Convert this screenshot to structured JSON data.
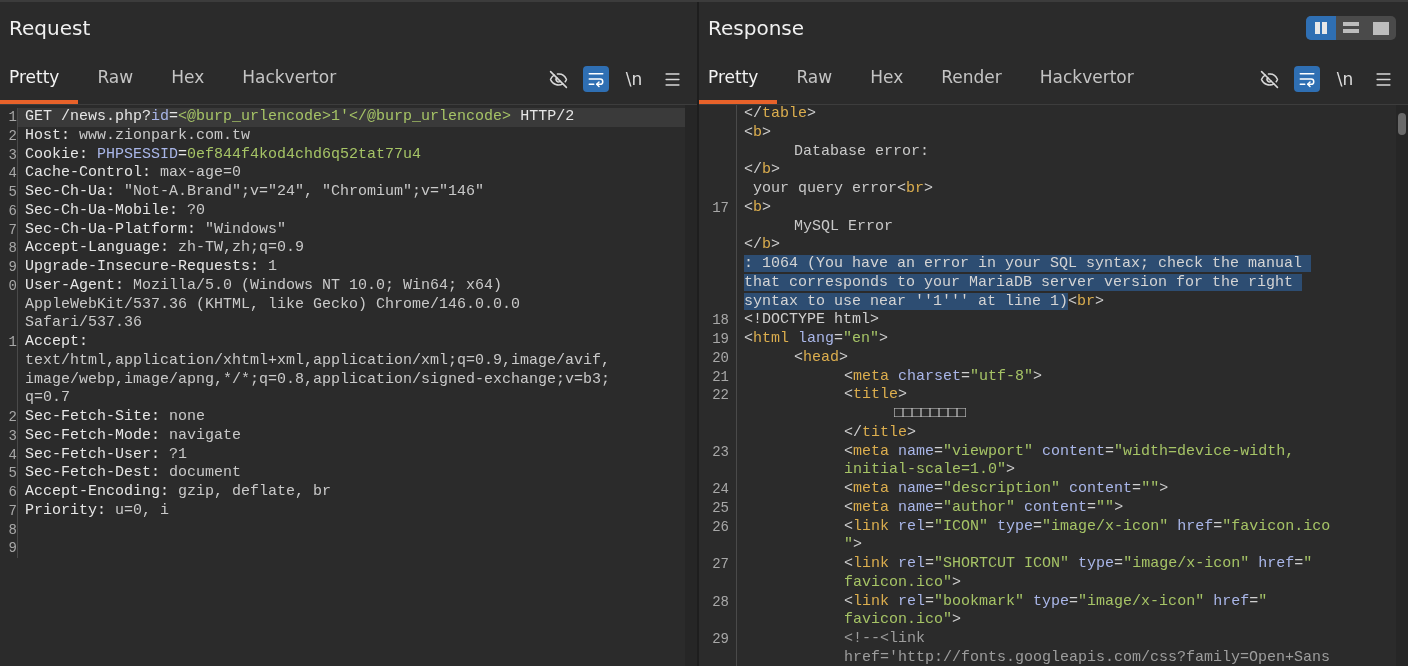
{
  "request": {
    "title": "Request",
    "tabs": [
      {
        "label": "Pretty",
        "selected": true
      },
      {
        "label": "Raw",
        "selected": false
      },
      {
        "label": "Hex",
        "selected": false
      },
      {
        "label": "Hackvertor",
        "selected": false
      }
    ],
    "toolbar": [
      {
        "kind": "hide",
        "active": false
      },
      {
        "kind": "wrap",
        "active": true
      },
      {
        "kind": "text",
        "label": "\\n",
        "active": false
      },
      {
        "kind": "menu",
        "active": false
      }
    ],
    "lines": [
      {
        "num": "1",
        "current": true,
        "spans": [
          {
            "kind": "k",
            "text": "GET /news.php?"
          },
          {
            "kind": "a",
            "text": "id"
          },
          {
            "kind": "k",
            "text": "="
          },
          {
            "kind": "v",
            "text": "<@burp_urlencode>1'</@burp_urlencode>"
          },
          {
            "kind": "k",
            "text": " HTTP/2"
          }
        ]
      },
      {
        "num": "2",
        "current": false,
        "spans": [
          {
            "kind": "k",
            "text": "Host: "
          },
          {
            "kind": "x",
            "text": "www.zionpark.com.tw"
          }
        ]
      },
      {
        "num": "3",
        "current": false,
        "spans": [
          {
            "kind": "k",
            "text": "Cookie: "
          },
          {
            "kind": "a",
            "text": "PHPSESSID"
          },
          {
            "kind": "k",
            "text": "="
          },
          {
            "kind": "v",
            "text": "0ef844f4kod4chd6q52tat77u4"
          }
        ]
      },
      {
        "num": "4",
        "current": false,
        "spans": [
          {
            "kind": "k",
            "text": "Cache-Control: "
          },
          {
            "kind": "x",
            "text": "max-age=0"
          }
        ]
      },
      {
        "num": "5",
        "current": false,
        "spans": [
          {
            "kind": "k",
            "text": "Sec-Ch-Ua: "
          },
          {
            "kind": "x",
            "text": "\"Not-A.Brand\";v=\"24\", \"Chromium\";v=\"146\""
          }
        ]
      },
      {
        "num": "6",
        "current": false,
        "spans": [
          {
            "kind": "k",
            "text": "Sec-Ch-Ua-Mobile: "
          },
          {
            "kind": "x",
            "text": "?0"
          }
        ]
      },
      {
        "num": "7",
        "current": false,
        "spans": [
          {
            "kind": "k",
            "text": "Sec-Ch-Ua-Platform: "
          },
          {
            "kind": "x",
            "text": "\"Windows\""
          }
        ]
      },
      {
        "num": "8",
        "current": false,
        "spans": [
          {
            "kind": "k",
            "text": "Accept-Language: "
          },
          {
            "kind": "x",
            "text": "zh-TW,zh;q=0.9"
          }
        ]
      },
      {
        "num": "9",
        "current": false,
        "spans": [
          {
            "kind": "k",
            "text": "Upgrade-Insecure-Requests: "
          },
          {
            "kind": "x",
            "text": "1"
          }
        ]
      },
      {
        "num": "0",
        "current": false,
        "spans": [
          {
            "kind": "k",
            "text": "User-Agent: "
          },
          {
            "kind": "x",
            "text": "Mozilla/5.0 (Windows NT 10.0; Win64; x64)"
          }
        ]
      },
      {
        "current": false,
        "spans": [
          {
            "kind": "x",
            "text": "AppleWebKit/537.36 (KHTML, like Gecko) Chrome/146.0.0.0"
          }
        ]
      },
      {
        "current": false,
        "spans": [
          {
            "kind": "x",
            "text": "Safari/537.36"
          }
        ]
      },
      {
        "num": "1",
        "current": false,
        "spans": [
          {
            "kind": "k",
            "text": "Accept:"
          }
        ]
      },
      {
        "current": false,
        "spans": [
          {
            "kind": "x",
            "text": "text/html,application/xhtml+xml,application/xml;q=0.9,image/avif,"
          }
        ]
      },
      {
        "current": false,
        "spans": [
          {
            "kind": "x",
            "text": "image/webp,image/apng,*/*;q=0.8,application/signed-exchange;v=b3;"
          }
        ]
      },
      {
        "current": false,
        "spans": [
          {
            "kind": "x",
            "text": "q=0.7"
          }
        ]
      },
      {
        "num": "2",
        "current": false,
        "spans": [
          {
            "kind": "k",
            "text": "Sec-Fetch-Site: "
          },
          {
            "kind": "x",
            "text": "none"
          }
        ]
      },
      {
        "num": "3",
        "current": false,
        "spans": [
          {
            "kind": "k",
            "text": "Sec-Fetch-Mode: "
          },
          {
            "kind": "x",
            "text": "navigate"
          }
        ]
      },
      {
        "num": "4",
        "current": false,
        "spans": [
          {
            "kind": "k",
            "text": "Sec-Fetch-User: "
          },
          {
            "kind": "x",
            "text": "?1"
          }
        ]
      },
      {
        "num": "5",
        "current": false,
        "spans": [
          {
            "kind": "k",
            "text": "Sec-Fetch-Dest: "
          },
          {
            "kind": "x",
            "text": "document"
          }
        ]
      },
      {
        "num": "6",
        "current": false,
        "spans": [
          {
            "kind": "k",
            "text": "Accept-Encoding: "
          },
          {
            "kind": "x",
            "text": "gzip, deflate, br"
          }
        ]
      },
      {
        "num": "7",
        "current": false,
        "spans": [
          {
            "kind": "k",
            "text": "Priority: "
          },
          {
            "kind": "x",
            "text": "u=0, i"
          }
        ]
      },
      {
        "num": "8",
        "current": false
      },
      {
        "num": "9",
        "current": false
      }
    ]
  },
  "response": {
    "title": "Response",
    "layout_buttons": [
      {
        "kind": "columns",
        "selected": true
      },
      {
        "kind": "rows",
        "selected": false
      },
      {
        "kind": "single",
        "selected": false
      }
    ],
    "tabs": [
      {
        "label": "Pretty",
        "selected": true
      },
      {
        "label": "Raw",
        "selected": false
      },
      {
        "label": "Hex",
        "selected": false
      },
      {
        "label": "Render",
        "selected": false
      },
      {
        "label": "Hackvertor",
        "selected": false
      }
    ],
    "toolbar": [
      {
        "kind": "hide",
        "active": false
      },
      {
        "kind": "wrap",
        "active": true
      },
      {
        "kind": "text",
        "label": "\\n",
        "active": false
      },
      {
        "kind": "menu",
        "active": false
      }
    ],
    "lines": [
      {
        "spans": [
          {
            "kind": "p",
            "text": "</"
          },
          {
            "kind": "t",
            "text": "table"
          },
          {
            "kind": "p",
            "text": ">"
          }
        ]
      },
      {
        "spans": [
          {
            "kind": "p",
            "text": "<"
          },
          {
            "kind": "t",
            "text": "b"
          },
          {
            "kind": "p",
            "text": ">"
          }
        ]
      },
      {
        "spans": [
          {
            "kind": "x",
            "text": "\tDatabase error:"
          }
        ]
      },
      {
        "spans": [
          {
            "kind": "p",
            "text": "</"
          },
          {
            "kind": "t",
            "text": "b"
          },
          {
            "kind": "p",
            "text": ">"
          }
        ]
      },
      {
        "spans": [
          {
            "kind": "x",
            "text": " your query error"
          },
          {
            "kind": "p",
            "text": "<"
          },
          {
            "kind": "t",
            "text": "br"
          },
          {
            "kind": "p",
            "text": ">"
          }
        ]
      },
      {
        "num": "17",
        "spans": [
          {
            "kind": "p",
            "text": "<"
          },
          {
            "kind": "t",
            "text": "b"
          },
          {
            "kind": "p",
            "text": ">"
          }
        ]
      },
      {
        "spans": [
          {
            "kind": "x",
            "text": "\tMySQL Error"
          }
        ]
      },
      {
        "spans": [
          {
            "kind": "p",
            "text": "</"
          },
          {
            "kind": "t",
            "text": "b"
          },
          {
            "kind": "p",
            "text": ">"
          }
        ]
      },
      {
        "spans": [
          {
            "kind": "s",
            "text": ": 1064 (You have an error in your SQL syntax; check the manual "
          }
        ]
      },
      {
        "spans": [
          {
            "kind": "s",
            "text": "that corresponds to your MariaDB server version for the right "
          }
        ]
      },
      {
        "spans": [
          {
            "kind": "s",
            "text": "syntax to use near ''1''' at line 1)"
          },
          {
            "kind": "p",
            "text": "<"
          },
          {
            "kind": "t",
            "text": "br"
          },
          {
            "kind": "p",
            "text": ">"
          }
        ]
      },
      {
        "num": "18",
        "spans": [
          {
            "kind": "p",
            "text": "<!DOCTYPE html>"
          }
        ]
      },
      {
        "num": "19",
        "spans": [
          {
            "kind": "p",
            "text": "<"
          },
          {
            "kind": "t",
            "text": "html"
          },
          {
            "kind": "a",
            "text": " lang"
          },
          {
            "kind": "p",
            "text": "="
          },
          {
            "kind": "v",
            "text": "\"en\""
          },
          {
            "kind": "p",
            "text": ">"
          }
        ]
      },
      {
        "num": "20",
        "spans": [
          {
            "kind": "p",
            "text": "\t<"
          },
          {
            "kind": "t",
            "text": "head"
          },
          {
            "kind": "p",
            "text": ">"
          }
        ]
      },
      {
        "num": "21",
        "spans": [
          {
            "kind": "p",
            "text": "\t\t<"
          },
          {
            "kind": "t",
            "text": "meta"
          },
          {
            "kind": "a",
            "text": " charset"
          },
          {
            "kind": "p",
            "text": "="
          },
          {
            "kind": "v",
            "text": "\"utf-8\""
          },
          {
            "kind": "p",
            "text": ">"
          }
        ]
      },
      {
        "num": "22",
        "spans": [
          {
            "kind": "p",
            "text": "\t\t<"
          },
          {
            "kind": "t",
            "text": "title"
          },
          {
            "kind": "p",
            "text": ">"
          }
        ]
      },
      {
        "spans": [
          {
            "kind": "x",
            "text": "\t\t\t□□□□□□□□"
          }
        ]
      },
      {
        "spans": [
          {
            "kind": "p",
            "text": "\t\t</"
          },
          {
            "kind": "t",
            "text": "title"
          },
          {
            "kind": "p",
            "text": ">"
          }
        ]
      },
      {
        "num": "23",
        "spans": [
          {
            "kind": "p",
            "text": "\t\t<"
          },
          {
            "kind": "t",
            "text": "meta"
          },
          {
            "kind": "a",
            "text": " name"
          },
          {
            "kind": "p",
            "text": "="
          },
          {
            "kind": "v",
            "text": "\"viewport\""
          },
          {
            "kind": "a",
            "text": " content"
          },
          {
            "kind": "p",
            "text": "="
          },
          {
            "kind": "v",
            "text": "\"width=device-width,"
          }
        ]
      },
      {
        "spans": [
          {
            "kind": "v",
            "text": "\t\tinitial-scale=1.0\""
          },
          {
            "kind": "p",
            "text": ">"
          }
        ]
      },
      {
        "num": "24",
        "spans": [
          {
            "kind": "p",
            "text": "\t\t<"
          },
          {
            "kind": "t",
            "text": "meta"
          },
          {
            "kind": "a",
            "text": " name"
          },
          {
            "kind": "p",
            "text": "="
          },
          {
            "kind": "v",
            "text": "\"description\""
          },
          {
            "kind": "a",
            "text": " content"
          },
          {
            "kind": "p",
            "text": "="
          },
          {
            "kind": "v",
            "text": "\"\""
          },
          {
            "kind": "p",
            "text": ">"
          }
        ]
      },
      {
        "num": "25",
        "spans": [
          {
            "kind": "p",
            "text": "\t\t<"
          },
          {
            "kind": "t",
            "text": "meta"
          },
          {
            "kind": "a",
            "text": " name"
          },
          {
            "kind": "p",
            "text": "="
          },
          {
            "kind": "v",
            "text": "\"author\""
          },
          {
            "kind": "a",
            "text": " content"
          },
          {
            "kind": "p",
            "text": "="
          },
          {
            "kind": "v",
            "text": "\"\""
          },
          {
            "kind": "p",
            "text": ">"
          }
        ]
      },
      {
        "num": "26",
        "spans": [
          {
            "kind": "p",
            "text": "\t\t<"
          },
          {
            "kind": "t",
            "text": "link"
          },
          {
            "kind": "a",
            "text": " rel"
          },
          {
            "kind": "p",
            "text": "="
          },
          {
            "kind": "v",
            "text": "\"ICON\""
          },
          {
            "kind": "a",
            "text": " type"
          },
          {
            "kind": "p",
            "text": "="
          },
          {
            "kind": "v",
            "text": "\"image/x-icon\""
          },
          {
            "kind": "a",
            "text": " href"
          },
          {
            "kind": "p",
            "text": "="
          },
          {
            "kind": "v",
            "text": "\"favicon.ico"
          }
        ]
      },
      {
        "spans": [
          {
            "kind": "v",
            "text": "\t\t\""
          },
          {
            "kind": "p",
            "text": ">"
          }
        ]
      },
      {
        "num": "27",
        "spans": [
          {
            "kind": "p",
            "text": "\t\t<"
          },
          {
            "kind": "t",
            "text": "link"
          },
          {
            "kind": "a",
            "text": " rel"
          },
          {
            "kind": "p",
            "text": "="
          },
          {
            "kind": "v",
            "text": "\"SHORTCUT ICON\""
          },
          {
            "kind": "a",
            "text": " type"
          },
          {
            "kind": "p",
            "text": "="
          },
          {
            "kind": "v",
            "text": "\"image/x-icon\""
          },
          {
            "kind": "a",
            "text": " href"
          },
          {
            "kind": "p",
            "text": "="
          },
          {
            "kind": "v",
            "text": "\""
          }
        ]
      },
      {
        "spans": [
          {
            "kind": "v",
            "text": "\t\tfavicon.ico\""
          },
          {
            "kind": "p",
            "text": ">"
          }
        ]
      },
      {
        "num": "28",
        "spans": [
          {
            "kind": "p",
            "text": "\t\t<"
          },
          {
            "kind": "t",
            "text": "link"
          },
          {
            "kind": "a",
            "text": " rel"
          },
          {
            "kind": "p",
            "text": "="
          },
          {
            "kind": "v",
            "text": "\"bookmark\""
          },
          {
            "kind": "a",
            "text": " type"
          },
          {
            "kind": "p",
            "text": "="
          },
          {
            "kind": "v",
            "text": "\"image/x-icon\""
          },
          {
            "kind": "a",
            "text": " href"
          },
          {
            "kind": "p",
            "text": "="
          },
          {
            "kind": "v",
            "text": "\""
          }
        ]
      },
      {
        "spans": [
          {
            "kind": "v",
            "text": "\t\tfavicon.ico\""
          },
          {
            "kind": "p",
            "text": ">"
          }
        ]
      },
      {
        "num": "29",
        "spans": [
          {
            "kind": "c",
            "text": "\t\t<!--<link"
          }
        ]
      },
      {
        "spans": [
          {
            "kind": "c",
            "text": "\t\thref='http://fonts.googleapis.com/css?family=Open+Sans"
          }
        ]
      }
    ]
  }
}
